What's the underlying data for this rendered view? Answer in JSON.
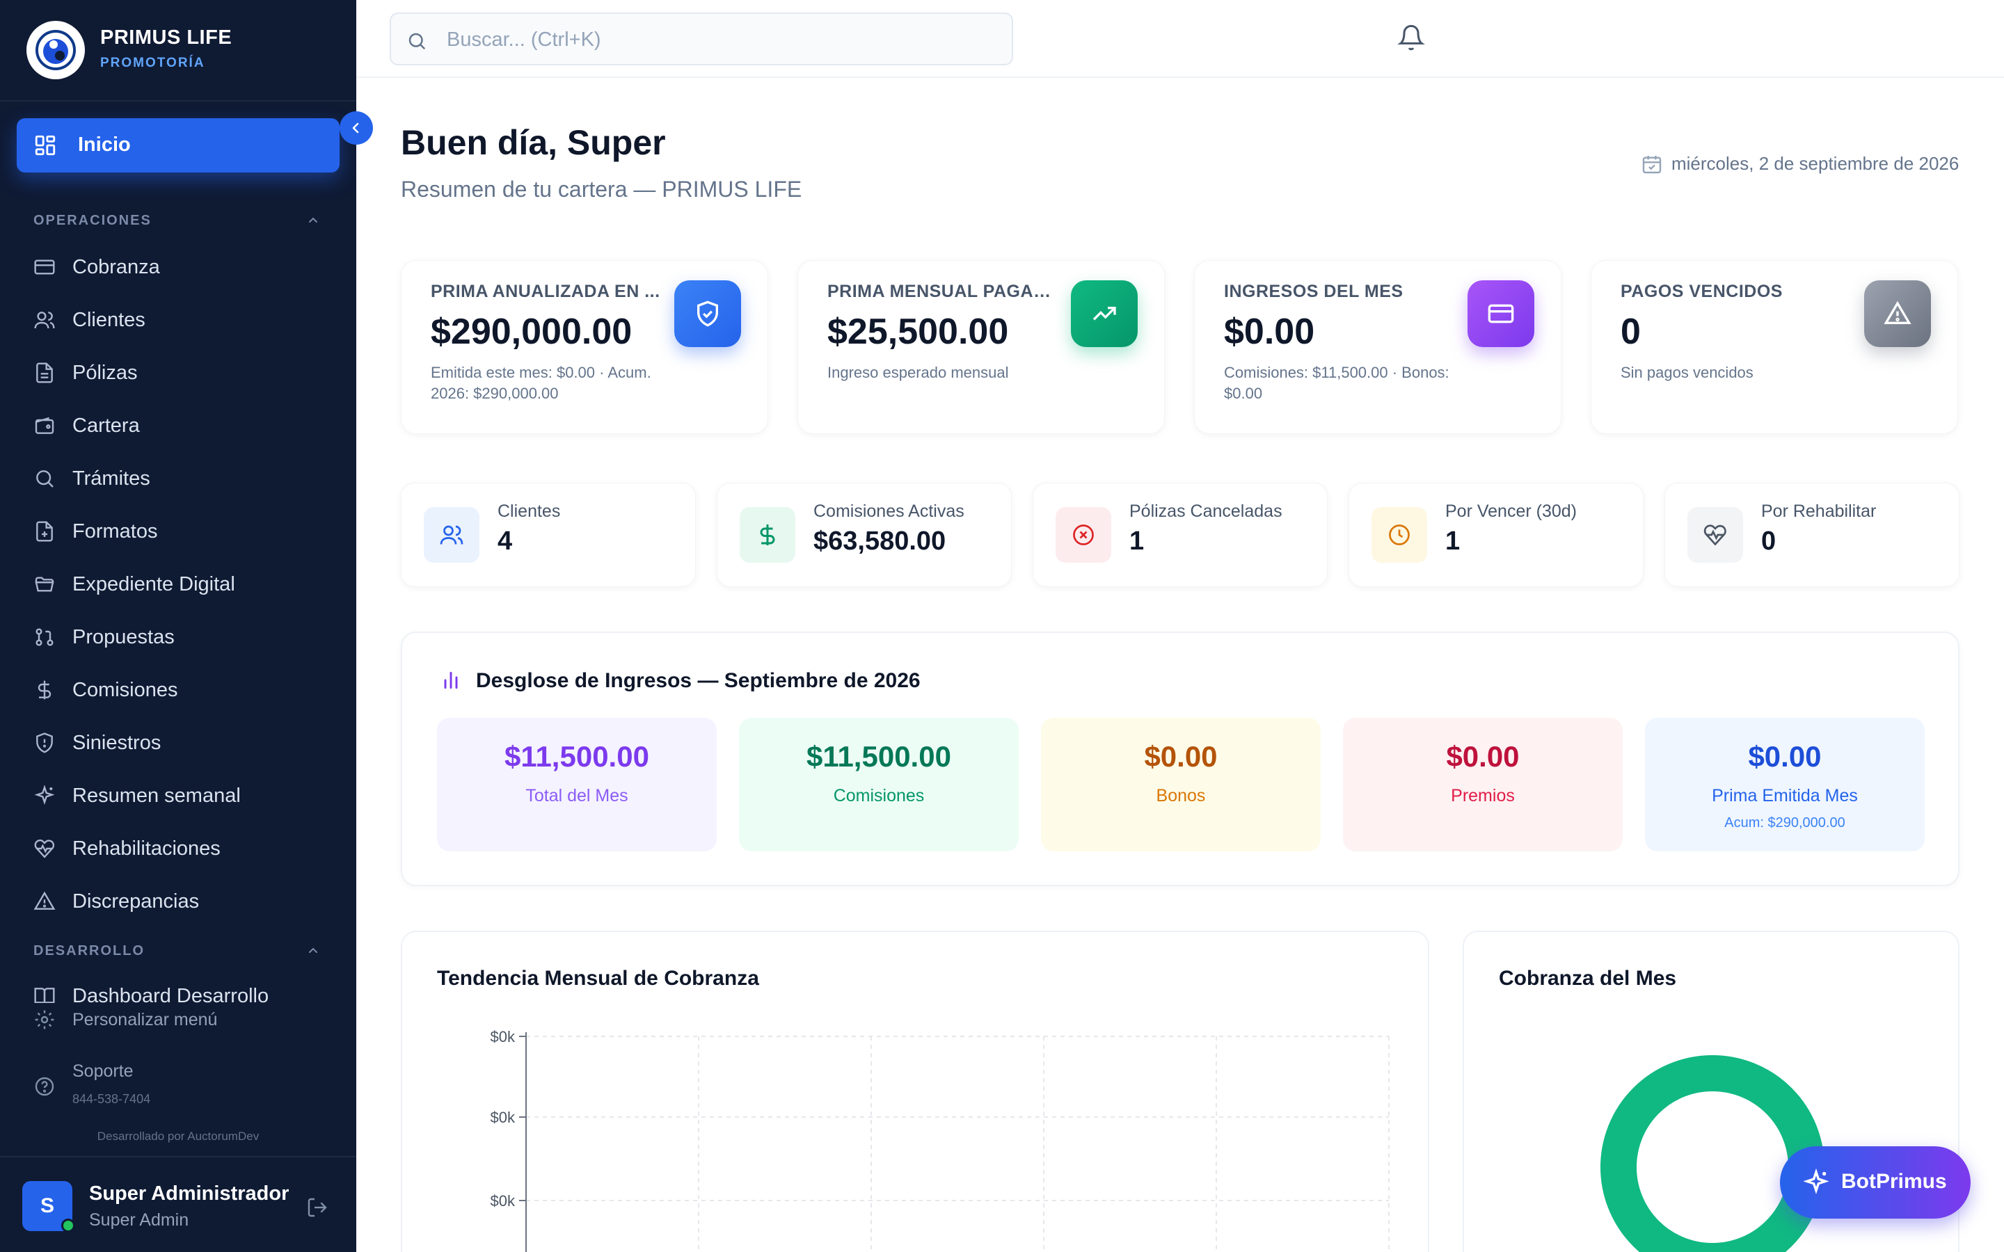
{
  "brand": {
    "name": "PRIMUS LIFE",
    "subtitle": "PROMOTORÍA"
  },
  "nav": {
    "active": "Inicio",
    "sections": [
      {
        "title": "OPERACIONES",
        "items": [
          "Cobranza",
          "Clientes",
          "Pólizas",
          "Cartera",
          "Trámites",
          "Formatos",
          "Expediente Digital",
          "Propuestas",
          "Comisiones",
          "Siniestros",
          "Resumen semanal",
          "Rehabilitaciones",
          "Discrepancias"
        ]
      },
      {
        "title": "DESARROLLO",
        "items": [
          "Dashboard Desarrollo"
        ]
      }
    ],
    "customize": "Personalizar menú",
    "support": {
      "label": "Soporte",
      "phone": "844-538-7404"
    },
    "credit": "Desarrollado por AuctorumDev"
  },
  "user": {
    "initial": "S",
    "name": "Super Administrador",
    "role": "Super Admin"
  },
  "search": {
    "placeholder": "Buscar... (Ctrl+K)"
  },
  "header": {
    "greeting": "Buen día, Super",
    "subtitle": "Resumen de tu cartera — PRIMUS LIFE",
    "date": "miércoles, 2 de septiembre de 2026"
  },
  "kpis": [
    {
      "label": "PRIMA ANUALIZADA EN ...",
      "value": "$290,000.00",
      "note": "Emitida este mes: $0.00 · Acum. 2026: $290,000.00",
      "icon": "shield-check-icon",
      "color": "#2563eb"
    },
    {
      "label": "PRIMA MENSUAL PAGADA",
      "value": "$25,500.00",
      "note": "Ingreso esperado mensual",
      "icon": "trending-up-icon",
      "color": "#10b981"
    },
    {
      "label": "INGRESOS DEL MES",
      "value": "$0.00",
      "note": "Comisiones: $11,500.00 · Bonos: $0.00",
      "icon": "credit-card-icon",
      "color": "#8b5cf6"
    },
    {
      "label": "PAGOS VENCIDOS",
      "value": "0",
      "note": "Sin pagos vencidos",
      "icon": "alert-triangle-icon",
      "color": "#6b7280"
    }
  ],
  "stats": [
    {
      "label": "Clientes",
      "value": "4",
      "icon": "users-icon"
    },
    {
      "label": "Comisiones Activas",
      "value": "$63,580.00",
      "icon": "dollar-icon"
    },
    {
      "label": "Pólizas Canceladas",
      "value": "1",
      "icon": "x-circle-icon"
    },
    {
      "label": "Por Vencer (30d)",
      "value": "1",
      "icon": "clock-icon"
    },
    {
      "label": "Por Rehabilitar",
      "value": "0",
      "icon": "heart-pulse-icon"
    }
  ],
  "breakdown": {
    "title": "Desglose de Ingresos — Septiembre de 2026",
    "items": [
      {
        "value": "$11,500.00",
        "label": "Total del Mes",
        "sub": ""
      },
      {
        "value": "$11,500.00",
        "label": "Comisiones",
        "sub": ""
      },
      {
        "value": "$0.00",
        "label": "Bonos",
        "sub": ""
      },
      {
        "value": "$0.00",
        "label": "Premios",
        "sub": ""
      },
      {
        "value": "$0.00",
        "label": "Prima Emitida Mes",
        "sub": "Acum: $290,000.00"
      }
    ]
  },
  "trend": {
    "title": "Tendencia Mensual de Cobranza"
  },
  "donut": {
    "title": "Cobranza del Mes"
  },
  "chart_data": [
    {
      "type": "line",
      "title": "Tendencia Mensual de Cobranza",
      "yticks": [
        "$0k",
        "$0k",
        "$0k"
      ],
      "grid": true,
      "series": []
    },
    {
      "type": "pie",
      "title": "Cobranza del Mes",
      "slices": [
        {
          "value": 1,
          "color": "#10b981"
        }
      ]
    }
  ],
  "bot": {
    "label": "BotPrimus"
  }
}
